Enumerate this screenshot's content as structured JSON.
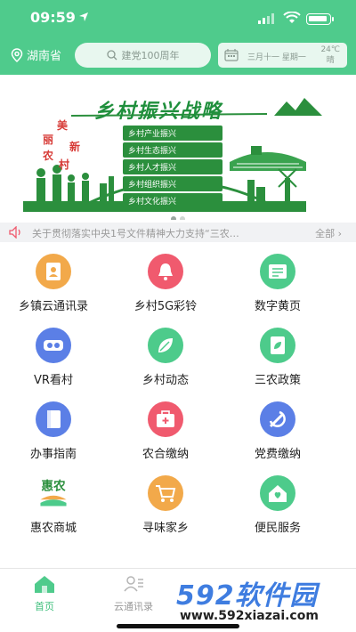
{
  "status": {
    "time": "09:59"
  },
  "header": {
    "region": "湖南省",
    "search_placeholder": "建党100周年",
    "date": "三月十一 星期一",
    "temp": "24℃",
    "weather": "晴"
  },
  "banner": {
    "title": "乡村振兴战略",
    "slogans": [
      "乡村产业振兴",
      "乡村生态振兴",
      "乡村人才振兴",
      "乡村组织振兴",
      "乡村文化振兴"
    ],
    "mei": [
      "美",
      "丽",
      "新",
      "农",
      "村"
    ]
  },
  "notice": {
    "text": "关于贯彻落实中央1号文件精神大力支持“三农…",
    "all": "全部"
  },
  "grid": [
    {
      "label": "乡镇云通讯录",
      "color": "#f2a94a",
      "icon": "contacts-icon"
    },
    {
      "label": "乡村5G彩铃",
      "color": "#f05a6e",
      "icon": "bell-icon"
    },
    {
      "label": "数字黄页",
      "color": "#4dcb8b",
      "icon": "yellow-pages-icon"
    },
    {
      "label": "VR看村",
      "color": "#5b7fe6",
      "icon": "vr-glasses-icon"
    },
    {
      "label": "乡村动态",
      "color": "#4dcb8b",
      "icon": "leaf-icon"
    },
    {
      "label": "三农政策",
      "color": "#4dcb8b",
      "icon": "policy-icon"
    },
    {
      "label": "办事指南",
      "color": "#5b7fe6",
      "icon": "book-icon"
    },
    {
      "label": "农合缴纳",
      "color": "#f05a6e",
      "icon": "medical-kit-icon"
    },
    {
      "label": "党费缴纳",
      "color": "#5b7fe6",
      "icon": "party-emblem-icon"
    },
    {
      "label": "惠农商城",
      "color": "#4dcb8b",
      "icon": "huinong-logo",
      "logo_text": "惠农"
    },
    {
      "label": "寻味家乡",
      "color": "#f2a94a",
      "icon": "cart-icon"
    },
    {
      "label": "便民服务",
      "color": "#4dcb8b",
      "icon": "house-heart-icon"
    }
  ],
  "tabs": [
    {
      "label": "首页",
      "active": true
    },
    {
      "label": "云通讯录",
      "active": false
    }
  ],
  "watermark": {
    "logo": "592软件园",
    "url": "www.592xiazai.com"
  },
  "colors": {
    "primary": "#4fcb8c",
    "active_tab": "#3fbf7c",
    "watermark": "#3f7de0"
  }
}
